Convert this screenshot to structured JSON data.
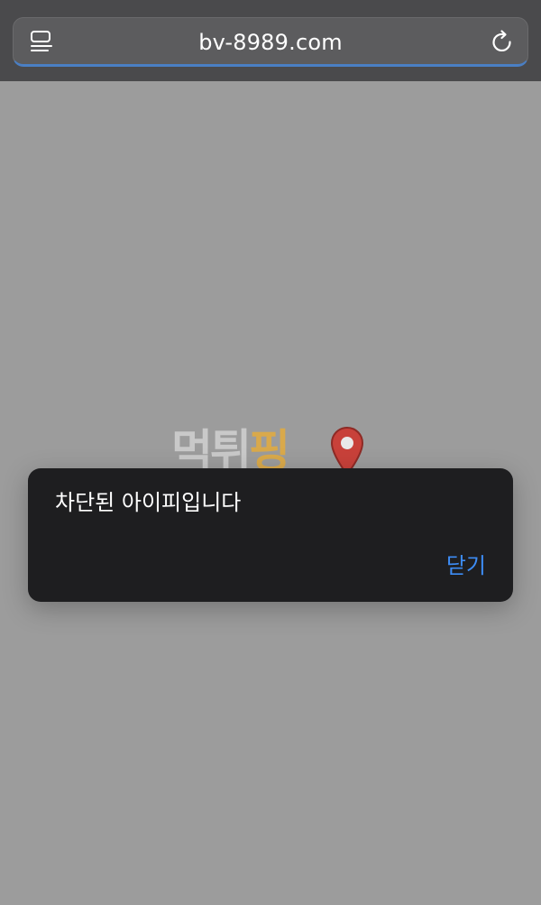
{
  "browser": {
    "url": "bv-8989.com",
    "tabs_icon": "tabs-icon",
    "reload_icon": "reload-icon",
    "accent": "#4a7fc4"
  },
  "watermark": {
    "part1": "먹",
    "part2": "튀",
    "part3": "핑",
    "pin_icon": "map-pin-icon"
  },
  "alert": {
    "message": "차단된 아이피입니다",
    "close_label": "닫기",
    "close_color": "#3d8cf5"
  }
}
